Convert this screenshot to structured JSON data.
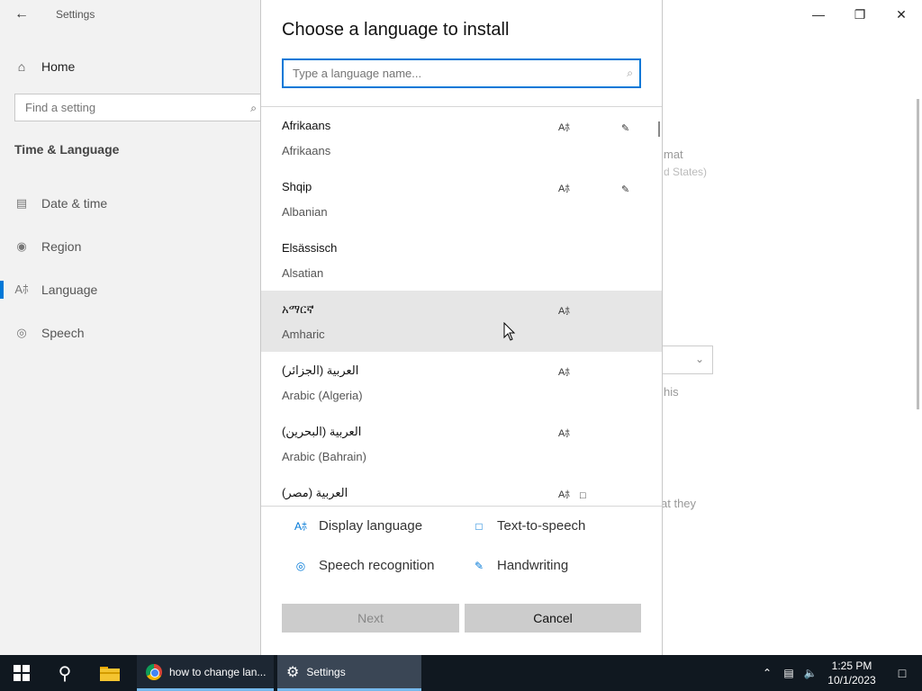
{
  "settings": {
    "title": "Settings",
    "home_label": "Home",
    "find_placeholder": "Find a setting",
    "section_title": "Time & Language",
    "nav": [
      {
        "label": "Date & time",
        "icon": "calendar-clock-icon"
      },
      {
        "label": "Region",
        "icon": "globe-icon"
      },
      {
        "label": "Language",
        "icon": "language-icon"
      },
      {
        "label": "Speech",
        "icon": "microphone-icon"
      }
    ],
    "background_fragments": {
      "format": "mat",
      "states": "d States)",
      "this": "his",
      "they": "at they"
    }
  },
  "dialog": {
    "title": "Choose a language to install",
    "search_placeholder": "Type a language name...",
    "languages": [
      {
        "native": "Afrikaans",
        "english": "Afrikaans",
        "features": [
          "display",
          "handwriting"
        ]
      },
      {
        "native": "Shqip",
        "english": "Albanian",
        "features": [
          "display",
          "handwriting"
        ]
      },
      {
        "native": "Elsässisch",
        "english": "Alsatian",
        "features": []
      },
      {
        "native": "አማርኛ",
        "english": "Amharic",
        "features": [
          "display"
        ]
      },
      {
        "native": "العربية (الجزائر)",
        "english": "Arabic (Algeria)",
        "features": [
          "display"
        ]
      },
      {
        "native": "العربية (البحرين)",
        "english": "Arabic (Bahrain)",
        "features": [
          "display"
        ]
      },
      {
        "native": "العربية (مصر)",
        "english": "",
        "features": [
          "display",
          "tts"
        ]
      }
    ],
    "legend": {
      "display": "Display language",
      "tts": "Text-to-speech",
      "speech": "Speech recognition",
      "handwriting": "Handwriting"
    },
    "next_label": "Next",
    "cancel_label": "Cancel"
  },
  "taskbar": {
    "chrome_label": "how to change lan...",
    "settings_label": "Settings",
    "time": "1:25 PM",
    "date": "10/1/2023"
  },
  "colors": {
    "accent": "#0078d7",
    "taskbar": "#101820",
    "button": "#cccccc"
  }
}
